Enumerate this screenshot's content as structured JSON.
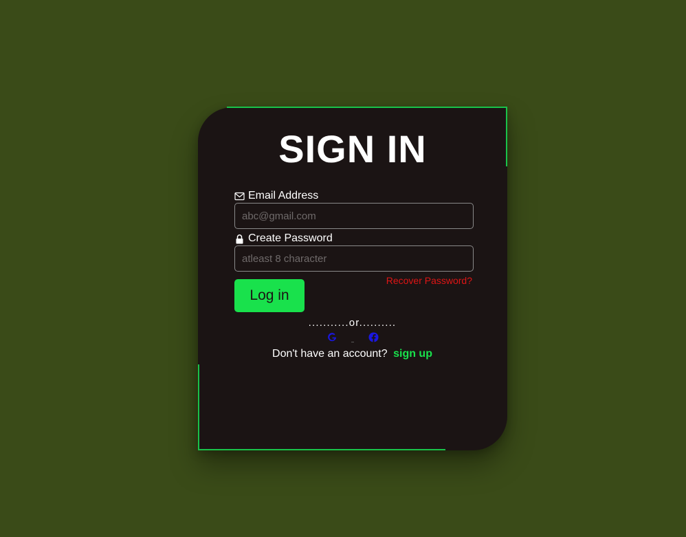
{
  "form": {
    "title": "SIGN IN",
    "email": {
      "label": "Email Address",
      "icon": "envelope-icon",
      "value": "",
      "placeholder": "abc@gmail.com"
    },
    "password": {
      "label": "Create Password",
      "icon": "lock-icon",
      "value": "",
      "placeholder": "atleast 8 character"
    },
    "recover_label": "Recover Password?",
    "login_label": "Log in",
    "divider_text": "...........or..........",
    "social": [
      {
        "name": "google-icon"
      },
      {
        "name": "facebook-icon"
      }
    ],
    "signup_prompt": "Don't have an account?",
    "signup_label": "sign up"
  },
  "colors": {
    "background": "#3a4b18",
    "card": "#1b1414",
    "accent": "#19e14c",
    "recover": "#e01515",
    "social_icon": "#1a17e0"
  }
}
